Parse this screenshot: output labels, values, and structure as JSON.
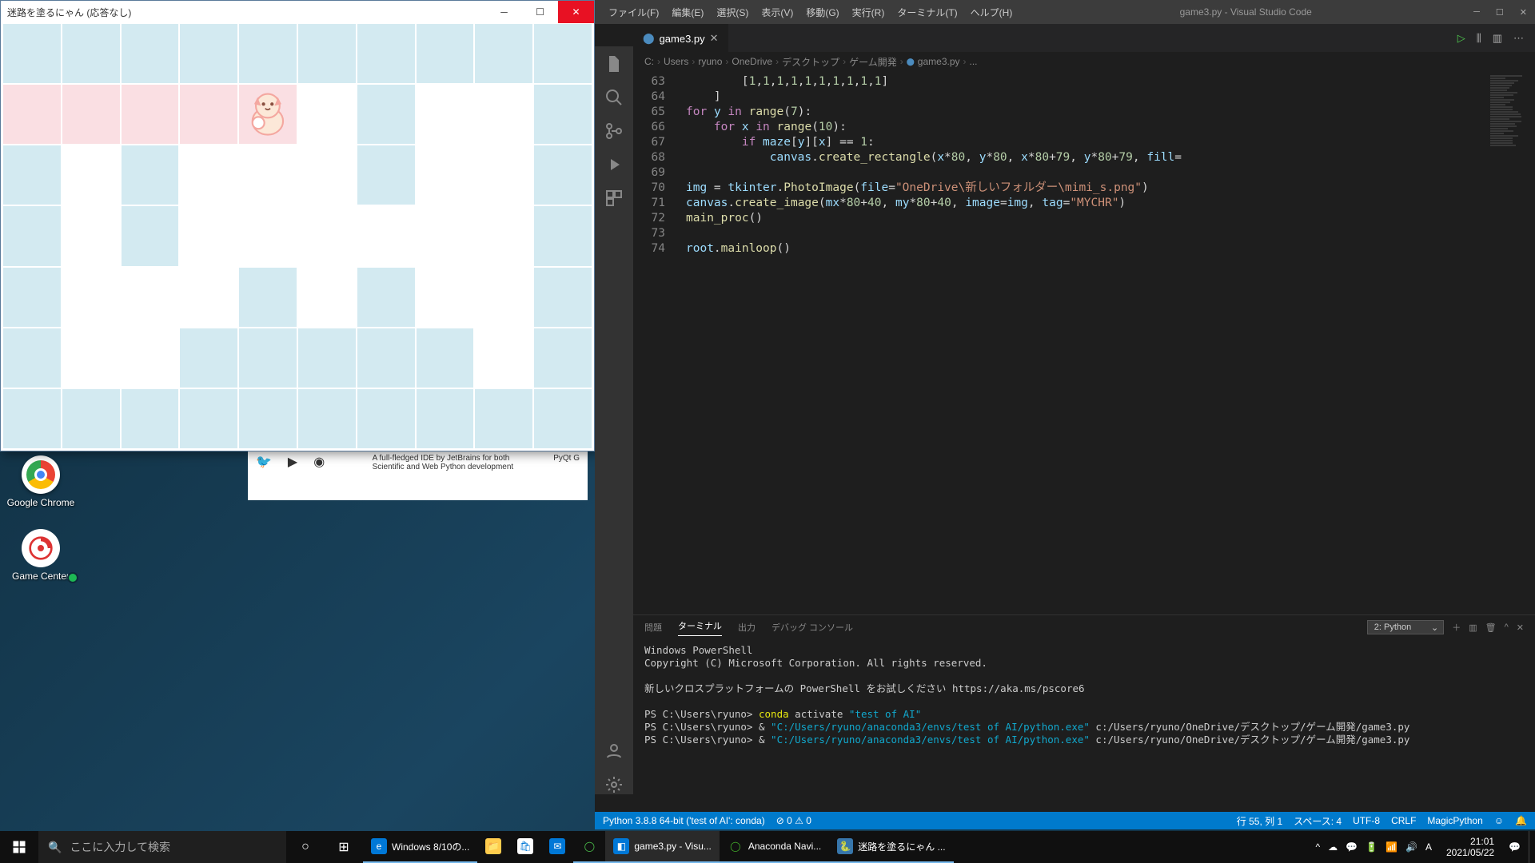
{
  "desktop": {
    "chrome_label": "Google Chrome",
    "gamecenter_label": "Game Center"
  },
  "game_window": {
    "title": "迷路を塗るにゃん (応答なし)",
    "maze": [
      [
        1,
        1,
        1,
        1,
        1,
        1,
        1,
        1,
        1,
        1
      ],
      [
        2,
        2,
        2,
        2,
        2,
        0,
        1,
        0,
        0,
        1
      ],
      [
        1,
        0,
        1,
        0,
        0,
        0,
        1,
        0,
        0,
        1
      ],
      [
        1,
        0,
        1,
        0,
        0,
        0,
        0,
        0,
        0,
        1
      ],
      [
        1,
        0,
        0,
        0,
        1,
        0,
        1,
        0,
        0,
        1
      ],
      [
        1,
        0,
        0,
        1,
        1,
        1,
        1,
        1,
        0,
        1
      ],
      [
        1,
        1,
        1,
        1,
        1,
        1,
        1,
        1,
        1,
        1
      ]
    ],
    "cat_pos": {
      "row": 1,
      "col": 4
    }
  },
  "vscode": {
    "menus": [
      "ファイル(F)",
      "編集(E)",
      "選択(S)",
      "表示(V)",
      "移動(G)",
      "実行(R)",
      "ターミナル(T)",
      "ヘルプ(H)"
    ],
    "title": "game3.py - Visual Studio Code",
    "tab": {
      "name": "game3.py",
      "dirty": true
    },
    "breadcrumb": [
      "C:",
      "Users",
      "ryuno",
      "OneDrive",
      "デスクトップ",
      "ゲーム開発",
      "game3.py",
      "..."
    ],
    "code_lines": [
      {
        "n": 63,
        "html": "        [<span class='tok-num'>1</span>,<span class='tok-num'>1</span>,<span class='tok-num'>1</span>,<span class='tok-num'>1</span>,<span class='tok-num'>1</span>,<span class='tok-num'>1</span>,<span class='tok-num'>1</span>,<span class='tok-num'>1</span>,<span class='tok-num'>1</span>,<span class='tok-num'>1</span>]"
      },
      {
        "n": 64,
        "html": "    ]"
      },
      {
        "n": 65,
        "html": "<span class='tok-kw'>for</span> <span class='tok-var'>y</span> <span class='tok-kw'>in</span> <span class='tok-fn'>range</span>(<span class='tok-num'>7</span>):"
      },
      {
        "n": 66,
        "html": "    <span class='tok-kw'>for</span> <span class='tok-var'>x</span> <span class='tok-kw'>in</span> <span class='tok-fn'>range</span>(<span class='tok-num'>10</span>):"
      },
      {
        "n": 67,
        "html": "        <span class='tok-kw'>if</span> <span class='tok-var'>maze</span>[<span class='tok-var'>y</span>][<span class='tok-var'>x</span>] == <span class='tok-num'>1</span>:"
      },
      {
        "n": 68,
        "html": "            <span class='tok-var'>canvas</span>.<span class='tok-fn'>create_rectangle</span>(<span class='tok-var'>x</span>*<span class='tok-num'>80</span>, <span class='tok-var'>y</span>*<span class='tok-num'>80</span>, <span class='tok-var'>x</span>*<span class='tok-num'>80</span>+<span class='tok-num'>79</span>, <span class='tok-var'>y</span>*<span class='tok-num'>80</span>+<span class='tok-num'>79</span>, <span class='tok-var'>fill</span>="
      },
      {
        "n": 69,
        "html": ""
      },
      {
        "n": 70,
        "html": "<span class='tok-var'>img</span> = <span class='tok-var'>tkinter</span>.<span class='tok-fn'>PhotoImage</span>(<span class='tok-var'>file</span>=<span class='tok-str'>\"OneDrive\\新しいフォルダー\\mimi_s.png\"</span>)"
      },
      {
        "n": 71,
        "html": "<span class='tok-var'>canvas</span>.<span class='tok-fn'>create_image</span>(<span class='tok-var'>mx</span>*<span class='tok-num'>80</span>+<span class='tok-num'>40</span>, <span class='tok-var'>my</span>*<span class='tok-num'>80</span>+<span class='tok-num'>40</span>, <span class='tok-var'>image</span>=<span class='tok-var'>img</span>, <span class='tok-var'>tag</span>=<span class='tok-str'>\"MYCHR\"</span>)"
      },
      {
        "n": 72,
        "html": "<span class='tok-fn'>main_proc</span>()"
      },
      {
        "n": 73,
        "html": ""
      },
      {
        "n": 74,
        "html": "<span class='tok-var'>root</span>.<span class='tok-fn'>mainloop</span>()"
      }
    ],
    "panel_tabs": {
      "problems": "問題",
      "terminal": "ターミナル",
      "output": "出力",
      "debug": "デバッグ コンソール"
    },
    "terminal_select": "2: Python",
    "terminal_lines": [
      {
        "t": "Windows PowerShell",
        "cls": "cmd"
      },
      {
        "t": "Copyright (C) Microsoft Corporation. All rights reserved.",
        "cls": "cmd"
      },
      {
        "t": "",
        "cls": ""
      },
      {
        "t": "新しいクロスプラットフォームの PowerShell をお試しください https://aka.ms/pscore6",
        "cls": "cmd"
      },
      {
        "t": "",
        "cls": ""
      },
      {
        "t": "PS C:\\Users\\ryuno> ",
        "cls": "cmd",
        "cont": [
          {
            "t": "conda",
            "c": "yellow"
          },
          {
            "t": " activate ",
            "c": "cmd"
          },
          {
            "t": "\"test of AI\"",
            "c": "cyan"
          }
        ]
      },
      {
        "t": "PS C:\\Users\\ryuno> & ",
        "cls": "cmd",
        "cont": [
          {
            "t": "\"C:/Users/ryuno/anaconda3/envs/test of AI/python.exe\"",
            "c": "cyan"
          },
          {
            "t": " c:/Users/ryuno/OneDrive/デスクトップ/ゲーム開発/game3.py",
            "c": "cmd"
          }
        ]
      },
      {
        "t": "PS C:\\Users\\ryuno> & ",
        "cls": "cmd",
        "cont": [
          {
            "t": "\"C:/Users/ryuno/anaconda3/envs/test of AI/python.exe\"",
            "c": "cyan"
          },
          {
            "t": " c:/Users/ryuno/OneDrive/デスクトップ/ゲーム開発/game3.py",
            "c": "cmd"
          }
        ]
      }
    ],
    "status": {
      "python": "Python 3.8.8 64-bit ('test of AI': conda)",
      "errors": "⊘ 0 ⚠ 0",
      "ln": "行 55, 列 1",
      "spaces": "スペース: 4",
      "enc": "UTF-8",
      "eol": "CRLF",
      "lang": "MagicPython"
    }
  },
  "taskbar": {
    "search_placeholder": "ここに入力して検索",
    "apps": [
      {
        "label": "Windows 8/10の...",
        "icon": "edge",
        "active": false,
        "running": true
      },
      {
        "label": "",
        "icon": "explorer",
        "active": false,
        "running": false
      },
      {
        "label": "",
        "icon": "store",
        "active": false,
        "running": false
      },
      {
        "label": "",
        "icon": "mail",
        "active": false,
        "running": false
      },
      {
        "label": "",
        "icon": "spinner",
        "active": false,
        "running": true
      },
      {
        "label": "game3.py - Visu...",
        "icon": "vscode",
        "active": true,
        "running": true
      },
      {
        "label": "Anaconda Navi...",
        "icon": "anaconda",
        "active": false,
        "running": true
      },
      {
        "label": "迷路を塗るにゃん ...",
        "icon": "python",
        "active": false,
        "running": true
      }
    ],
    "time": "21:01",
    "date": "2021/05/22"
  },
  "fragment": {
    "line1": "A full-fledged IDE by JetBrains for both",
    "line2": "Scientific and Web Python development",
    "pyqt": "PyQt G"
  }
}
